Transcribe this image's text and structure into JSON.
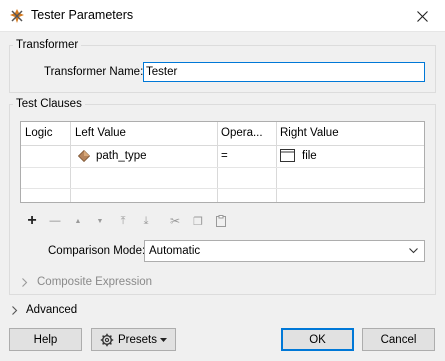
{
  "window": {
    "title": "Tester Parameters",
    "close_glyph": "✕"
  },
  "transformer": {
    "group_label": "Transformer",
    "name_label": "Transformer Name:",
    "name_value": "Tester"
  },
  "test_clauses": {
    "group_label": "Test Clauses",
    "columns": [
      "Logic",
      "Left Value",
      "Opera...",
      "Right Value"
    ],
    "rows": [
      {
        "logic": "",
        "left_value": "path_type",
        "left_icon": "attribute-diamond-icon",
        "operator": "=",
        "right_value": "file",
        "right_icon": "text-value-icon"
      }
    ],
    "toolbar": [
      {
        "name": "add-row-icon",
        "glyph": "+"
      },
      {
        "name": "remove-row-icon",
        "glyph": "—"
      },
      {
        "name": "move-up-icon",
        "glyph": "▲"
      },
      {
        "name": "move-down-icon",
        "glyph": "▼"
      },
      {
        "name": "move-top-icon",
        "glyph": "⤒"
      },
      {
        "name": "move-bottom-icon",
        "glyph": "⤓"
      },
      {
        "name": "cut-icon",
        "glyph": "✂"
      },
      {
        "name": "copy-icon",
        "glyph": "❐"
      },
      {
        "name": "paste-icon",
        "glyph": "📋"
      }
    ],
    "comparison_mode_label": "Comparison Mode:",
    "comparison_mode_value": "Automatic",
    "composite_expression_label": "Composite Expression"
  },
  "advanced_label": "Advanced",
  "buttons": {
    "help": "Help",
    "presets": "Presets",
    "ok": "OK",
    "cancel": "Cancel"
  },
  "colors": {
    "accent": "#0078d7",
    "icon_brown": "#b5835a"
  }
}
